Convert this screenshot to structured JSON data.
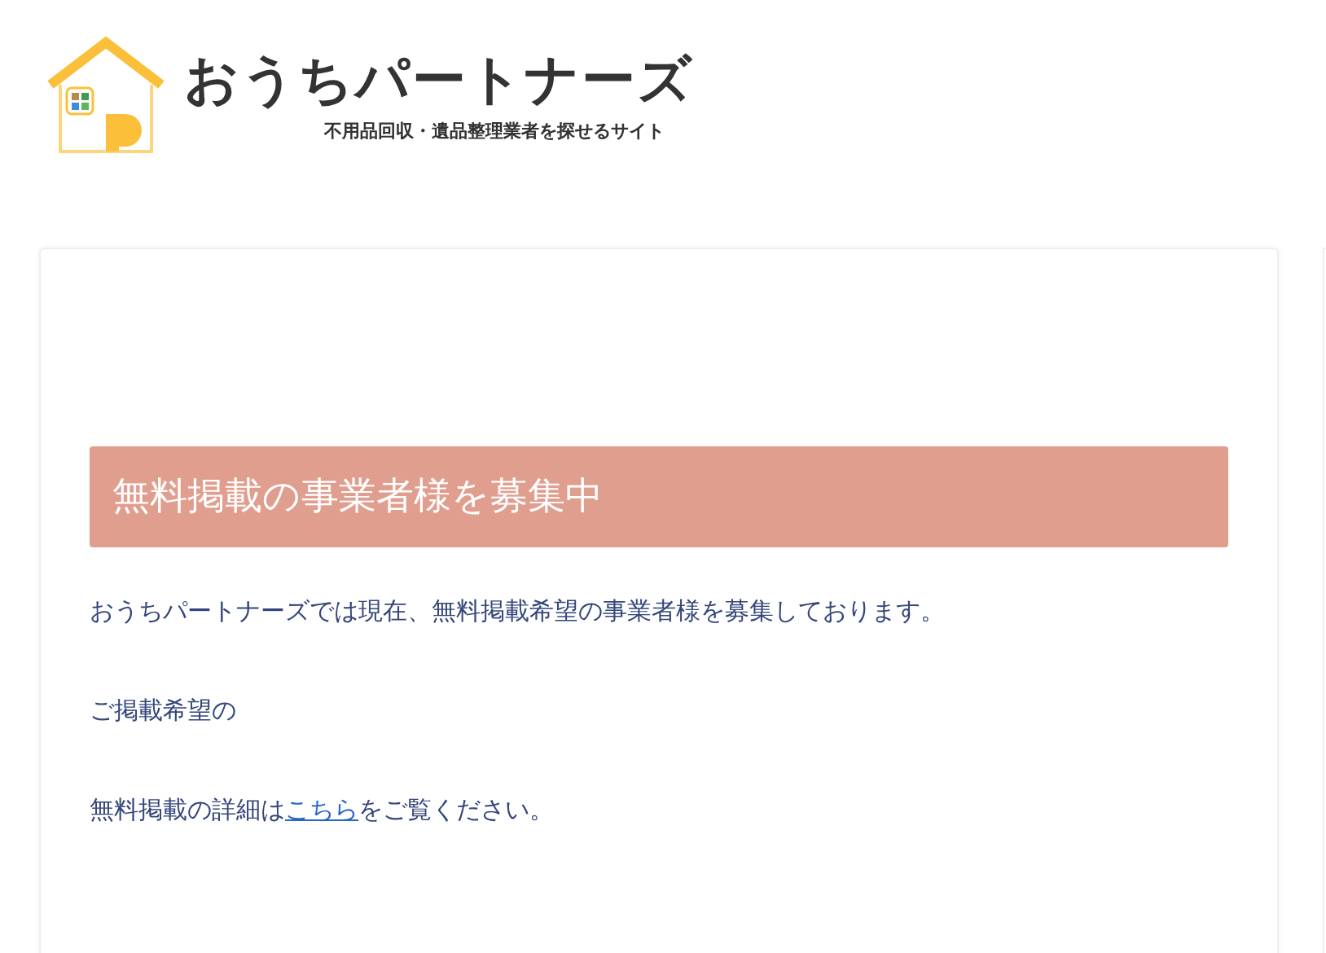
{
  "logo": {
    "title": "おうちパートナーズ",
    "tagline": "不用品回収・遺品整理業者を探せるサイト"
  },
  "article": {
    "heading": "無料掲載の事業者様を募集中",
    "paragraphs": [
      {
        "text": "おうちパートナーズでは現在、無料掲載希望の事業者様を募集しております。"
      },
      {
        "text": "ご掲載希望の"
      },
      {
        "text": "無料掲載の詳細は",
        "link": "こちら",
        "after": "をご覧ください。"
      }
    ]
  }
}
